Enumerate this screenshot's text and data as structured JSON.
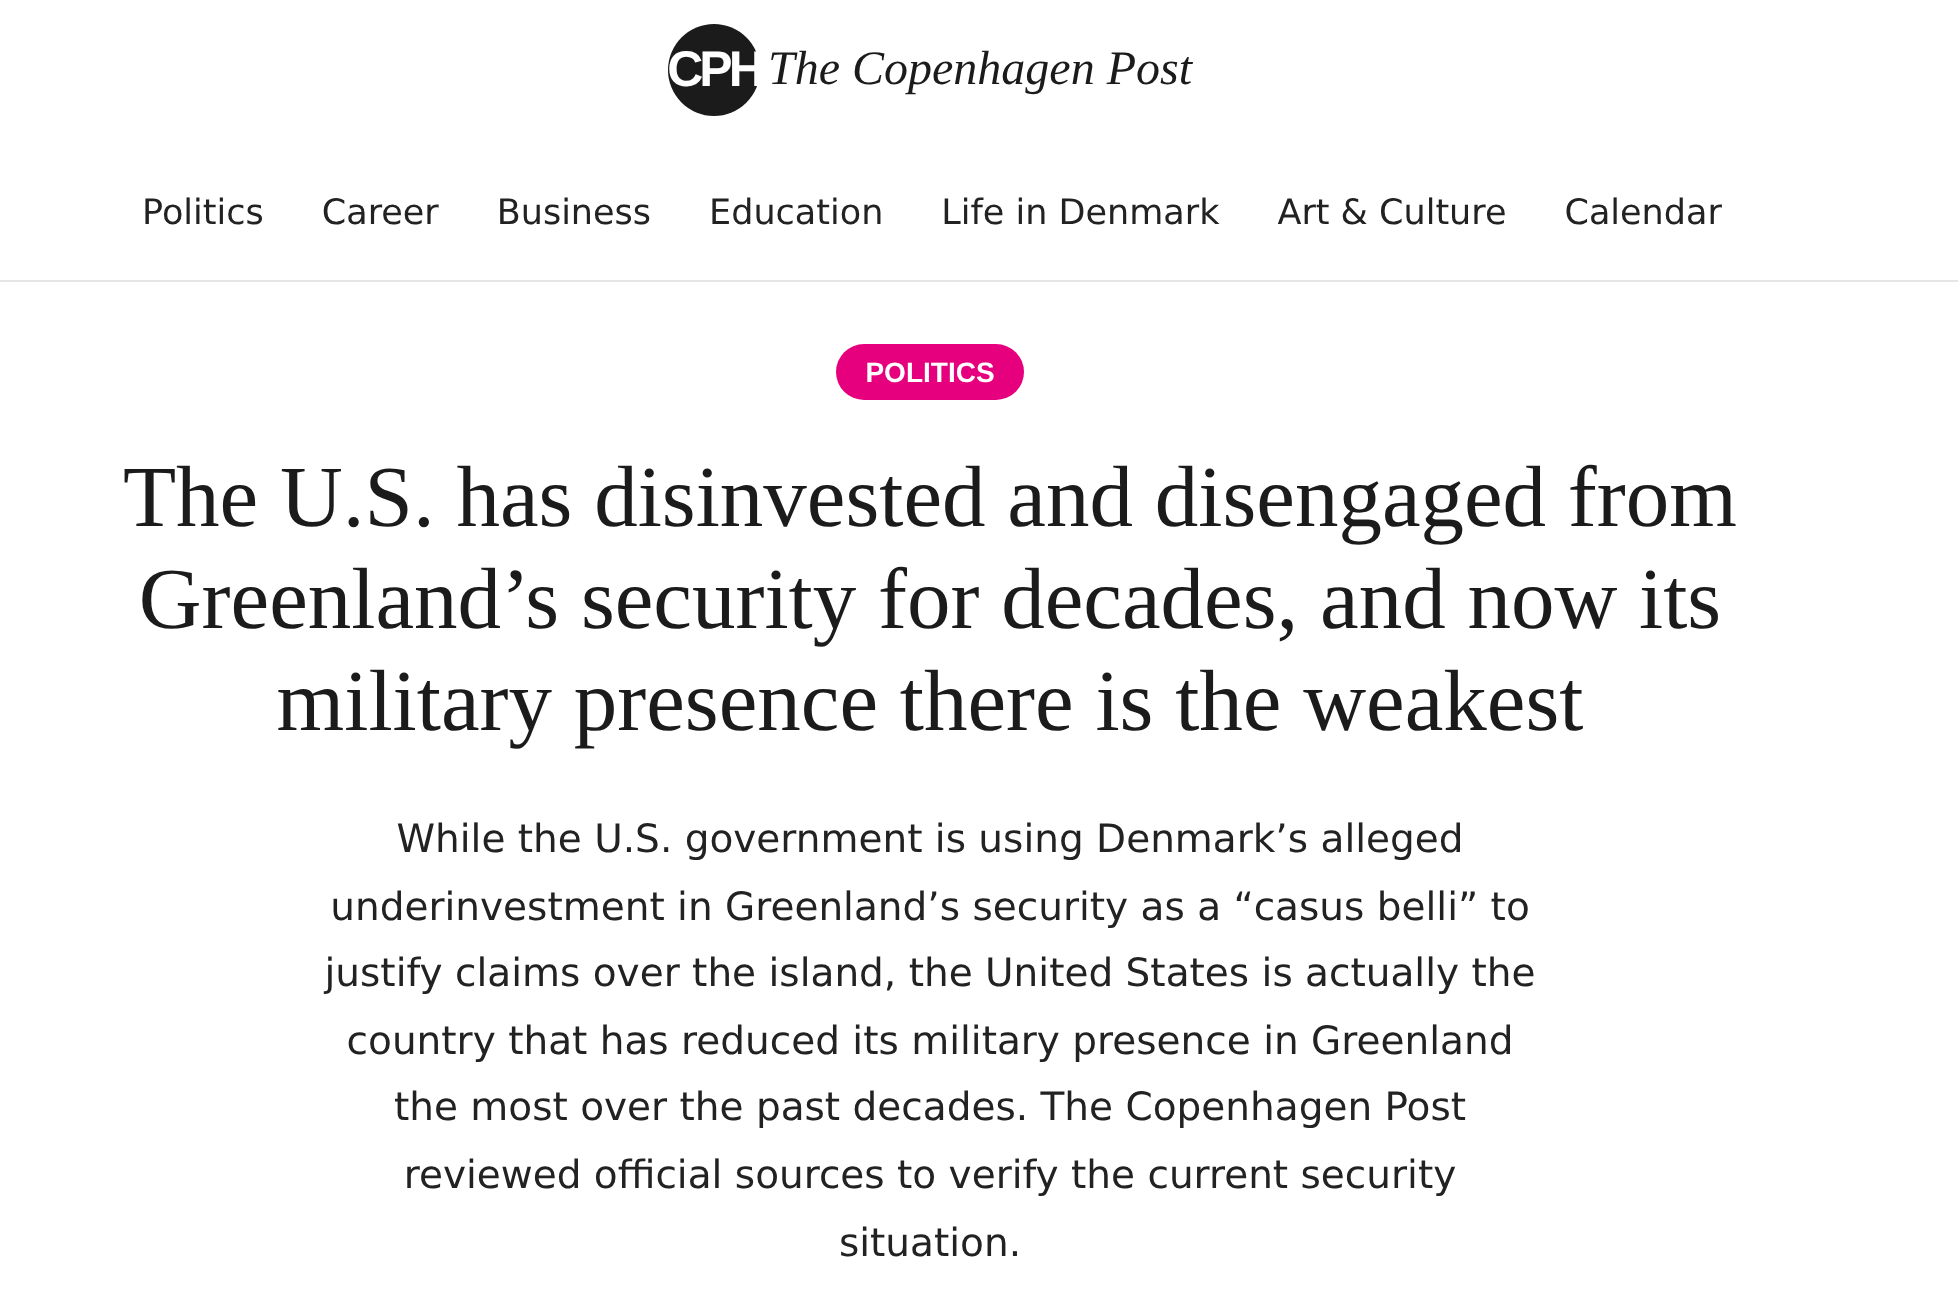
{
  "logo": {
    "mark": "CPH",
    "name": "The Copenhagen Post"
  },
  "nav": {
    "items": [
      {
        "label": "Politics"
      },
      {
        "label": "Career"
      },
      {
        "label": "Business"
      },
      {
        "label": "Education"
      },
      {
        "label": "Life in Denmark"
      },
      {
        "label": "Art & Culture"
      },
      {
        "label": "Calendar"
      }
    ]
  },
  "article": {
    "category": "POLITICS",
    "headline": "The U.S. has disinvested and disengaged from Greenland’s security for decades, and now its military presence there is the weakest",
    "lede": "While the U.S. government is using Denmark’s alleged underinvestment in Greenland’s security as a “casus belli” to justify claims over the island, the United States is actually the country that has reduced its military presence in Greenland the most over the past decades. The Copenhagen Post reviewed official sources to verify the current security situation."
  }
}
